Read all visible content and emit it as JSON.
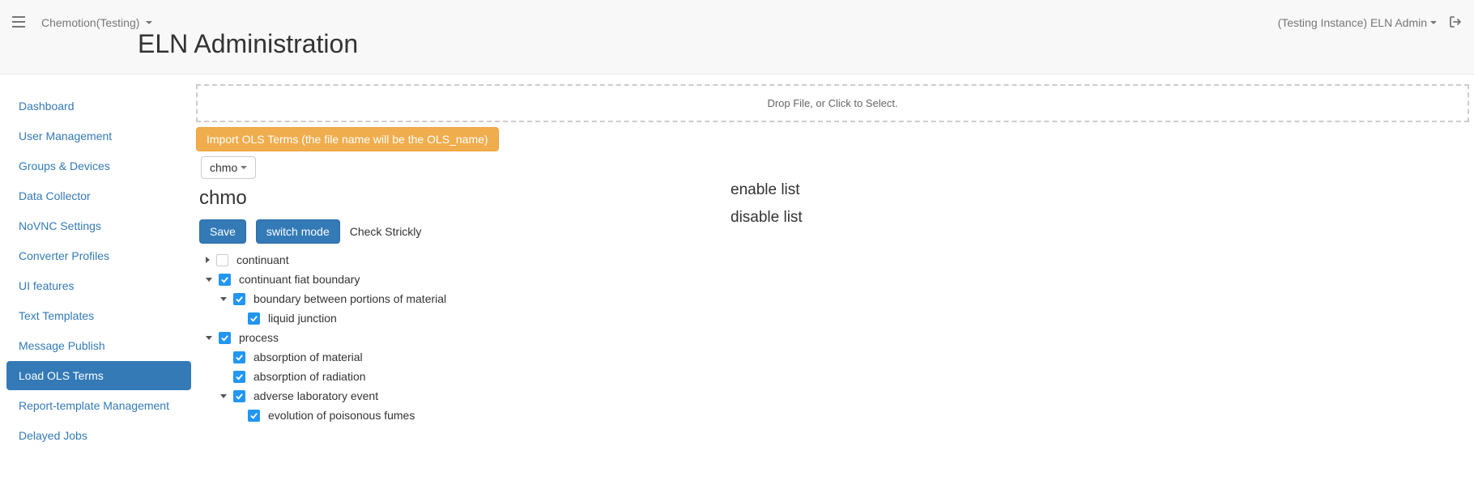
{
  "header": {
    "brand": "Chemotion(Testing)",
    "title": "ELN Administration",
    "user_label": "(Testing Instance) ELN Admin"
  },
  "sidebar": {
    "items": [
      {
        "label": "Dashboard",
        "active": false
      },
      {
        "label": "User Management",
        "active": false
      },
      {
        "label": "Groups & Devices",
        "active": false
      },
      {
        "label": "Data Collector",
        "active": false
      },
      {
        "label": "NoVNC Settings",
        "active": false
      },
      {
        "label": "Converter Profiles",
        "active": false
      },
      {
        "label": "UI features",
        "active": false
      },
      {
        "label": "Text Templates",
        "active": false
      },
      {
        "label": "Message Publish",
        "active": false
      },
      {
        "label": "Load OLS Terms",
        "active": true
      },
      {
        "label": "Report-template Management",
        "active": false
      },
      {
        "label": "Delayed Jobs",
        "active": false
      }
    ]
  },
  "content": {
    "dropzone_text": "Drop File, or Click to Select.",
    "import_button": "Import OLS Terms (the file name will be the OLS_name)",
    "ontology_selector": "chmo",
    "ontology_heading": "chmo",
    "save_button": "Save",
    "switch_mode_button": "switch mode",
    "check_strictly_label": "Check Strickly",
    "enable_list_title": "enable list",
    "disable_list_title": "disable list",
    "tree": [
      {
        "level": 1,
        "toggle": "collapsed",
        "checked": false,
        "label": "continuant"
      },
      {
        "level": 1,
        "toggle": "expanded",
        "checked": true,
        "label": "continuant fiat boundary"
      },
      {
        "level": 2,
        "toggle": "expanded",
        "checked": true,
        "label": "boundary between portions of material"
      },
      {
        "level": 3,
        "toggle": "none",
        "checked": true,
        "label": "liquid junction"
      },
      {
        "level": 1,
        "toggle": "expanded",
        "checked": true,
        "label": "process"
      },
      {
        "level": 2,
        "toggle": "none",
        "checked": true,
        "label": "absorption of material"
      },
      {
        "level": 2,
        "toggle": "none",
        "checked": true,
        "label": "absorption of radiation"
      },
      {
        "level": 2,
        "toggle": "expanded",
        "checked": true,
        "label": "adverse laboratory event"
      },
      {
        "level": 3,
        "toggle": "none",
        "checked": true,
        "label": "evolution of poisonous fumes"
      }
    ]
  }
}
